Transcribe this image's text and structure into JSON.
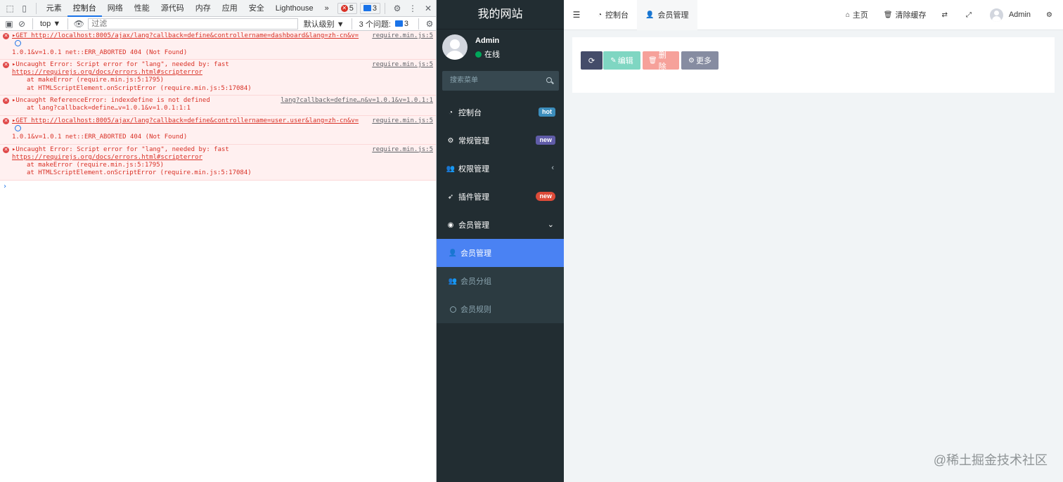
{
  "devtools": {
    "tabs": [
      "元素",
      "控制台",
      "网络",
      "性能",
      "源代码",
      "内存",
      "应用",
      "安全",
      "Lighthouse"
    ],
    "active_tab": "控制台",
    "more_tabs": "»",
    "error_count": "5",
    "message_count": "3",
    "context": "top ▼",
    "filter_placeholder": "过滤",
    "level": "默认级别 ▼",
    "issues_label": "3 个问题:",
    "issues_count": "3",
    "messages": [
      {
        "lines": [
          "▸GET http://localhost:8005/ajax/lang?callback=define&controllername=dashboard&lang=zh-cn&v=",
          "1.0.1&v=1.0.1 net::ERR_ABORTED 404 (Not Found)"
        ],
        "source": "require.min.js:5"
      },
      {
        "lines": [
          "▸Uncaught Error: Script error for \"lang\", needed by: fast",
          "https://requirejs.org/docs/errors.html#scripterror",
          "at makeError (require.min.js:5:1795)",
          "at HTMLScriptElement.onScriptError (require.min.js:5:17084)"
        ],
        "source": "require.min.js:5"
      },
      {
        "lines": [
          "▸Uncaught ReferenceError: indexdefine is not defined",
          "at lang?callback=define…v=1.0.1&v=1.0.1:1:1"
        ],
        "source": "lang?callback=define…n&v=1.0.1&v=1.0.1:1"
      },
      {
        "lines": [
          "▸GET http://localhost:8005/ajax/lang?callback=define&controllername=user.user&lang=zh-cn&v=",
          "1.0.1&v=1.0.1 net::ERR_ABORTED 404 (Not Found)"
        ],
        "source": "require.min.js:5"
      },
      {
        "lines": [
          "▸Uncaught Error: Script error for \"lang\", needed by: fast",
          "https://requirejs.org/docs/errors.html#scripterror",
          "at makeError (require.min.js:5:1795)",
          "at HTMLScriptElement.onScriptError (require.min.js:5:17084)"
        ],
        "source": "require.min.js:5"
      }
    ],
    "prompt": "›"
  },
  "app": {
    "title": "我的网站",
    "user": {
      "name": "Admin",
      "status": "在线"
    },
    "search_placeholder": "搜索菜单",
    "menu": [
      {
        "label": "控制台",
        "badge": "hot",
        "badge_color": "#3c8dbc"
      },
      {
        "label": "常规管理",
        "badge": "new",
        "badge_color": "#605ca8"
      },
      {
        "label": "权限管理",
        "chevron": "‹"
      },
      {
        "label": "插件管理",
        "badge": "new",
        "badge_color": "#dd4b39"
      },
      {
        "label": "会员管理",
        "chevron": "⌄"
      }
    ],
    "submenu": [
      {
        "label": "会员管理"
      },
      {
        "label": "会员分组"
      },
      {
        "label": "会员规则"
      }
    ],
    "nav_tabs": [
      "控制台",
      "会员管理"
    ],
    "nav_links": {
      "home": "主页",
      "clear_cache": "清除缓存",
      "admin": "Admin"
    },
    "buttons": {
      "edit": "编辑",
      "delete": "删除",
      "more": "更多"
    },
    "colors": {
      "sidebar_bg": "#222d32",
      "active_item": "#4a82f3",
      "refresh_btn": "#444c69",
      "edit_btn": "#7fd6c2",
      "delete_btn": "#f6a19a",
      "more_btn": "#868ca1"
    }
  },
  "watermark": "@稀土掘金技术社区"
}
